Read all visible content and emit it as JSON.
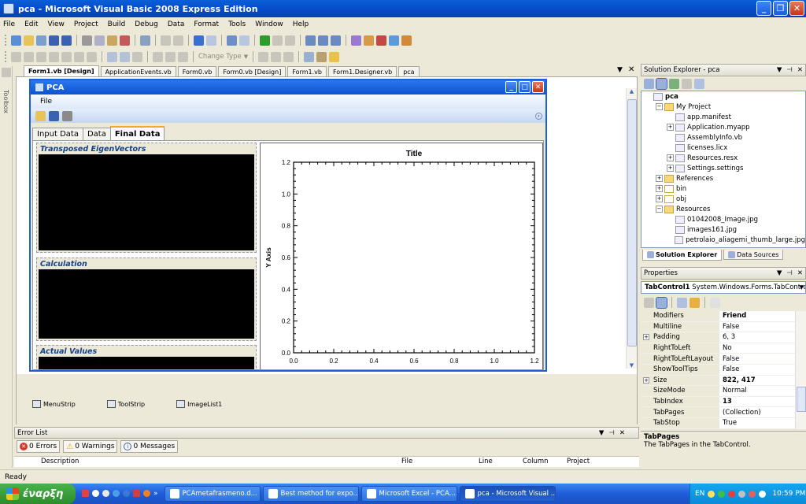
{
  "window": {
    "title": "pca - Microsoft Visual Basic 2008 Express Edition"
  },
  "menu": [
    "File",
    "Edit",
    "View",
    "Project",
    "Build",
    "Debug",
    "Data",
    "Format",
    "Tools",
    "Window",
    "Help"
  ],
  "toolbar2": {
    "change_type": "Change Type"
  },
  "toolbox": {
    "label": "Toolbox"
  },
  "doc_tabs": [
    "Form1.vb [Design]",
    "ApplicationEvents.vb",
    "Form0.vb",
    "Form0.vb [Design]",
    "Form1.vb",
    "Form1.Designer.vb",
    "pca"
  ],
  "form": {
    "title": "PCA",
    "menu_file": "File",
    "tabs": [
      "Input Data",
      "Data",
      "Final Data"
    ],
    "panels": {
      "eigen": "Transposed EigenVectors",
      "calc": "Calculation",
      "actual": "Actual Values"
    }
  },
  "chart_data": {
    "type": "scatter",
    "title": "Title",
    "xlabel": "",
    "ylabel": "Y Axis",
    "xlim": [
      0,
      1.2
    ],
    "ylim": [
      0,
      1.2
    ],
    "xticks": [
      "0.0",
      "0.2",
      "0.4",
      "0.6",
      "0.8",
      "1.0",
      "1.2"
    ],
    "yticks": [
      "0.0",
      "0.2",
      "0.4",
      "0.6",
      "0.8",
      "1.0",
      "1.2"
    ],
    "series": []
  },
  "component_tray": [
    "MenuStrip",
    "ToolStrip",
    "ImageList1"
  ],
  "solution_explorer": {
    "title": "Solution Explorer - pca",
    "items": [
      {
        "label": "pca",
        "level": 0,
        "expander": "",
        "icon": "project",
        "bold": true
      },
      {
        "label": "My Project",
        "level": 1,
        "expander": "−",
        "icon": "folder",
        "bold": false
      },
      {
        "label": "app.manifest",
        "level": 2,
        "expander": "",
        "icon": "file",
        "bold": false
      },
      {
        "label": "Application.myapp",
        "level": 2,
        "expander": "+",
        "icon": "file",
        "bold": false
      },
      {
        "label": "AssemblyInfo.vb",
        "level": 2,
        "expander": "",
        "icon": "file",
        "bold": false
      },
      {
        "label": "licenses.licx",
        "level": 2,
        "expander": "",
        "icon": "file",
        "bold": false
      },
      {
        "label": "Resources.resx",
        "level": 2,
        "expander": "+",
        "icon": "file",
        "bold": false
      },
      {
        "label": "Settings.settings",
        "level": 2,
        "expander": "+",
        "icon": "file",
        "bold": false
      },
      {
        "label": "References",
        "level": 1,
        "expander": "+",
        "icon": "folder",
        "bold": false
      },
      {
        "label": "bin",
        "level": 1,
        "expander": "+",
        "icon": "folder-plain",
        "bold": false
      },
      {
        "label": "obj",
        "level": 1,
        "expander": "+",
        "icon": "folder-plain",
        "bold": false
      },
      {
        "label": "Resources",
        "level": 1,
        "expander": "−",
        "icon": "folder",
        "bold": false
      },
      {
        "label": "01042008_Image.jpg",
        "level": 2,
        "expander": "",
        "icon": "file",
        "bold": false
      },
      {
        "label": "images161.jpg",
        "level": 2,
        "expander": "",
        "icon": "file",
        "bold": false
      },
      {
        "label": "petrolaio_aliagemi_thumb_large.jpg",
        "level": 2,
        "expander": "",
        "icon": "file",
        "bold": false
      }
    ],
    "bottom_tabs": [
      "Solution Explorer",
      "Data Sources"
    ]
  },
  "properties": {
    "title": "Properties",
    "object_name": "TabControl1",
    "object_type": "System.Windows.Forms.TabContro",
    "rows": [
      {
        "name": "Modifiers",
        "value": "Friend",
        "bold": true,
        "expander": ""
      },
      {
        "name": "Multiline",
        "value": "False",
        "bold": false,
        "expander": ""
      },
      {
        "name": "Padding",
        "value": "6, 3",
        "bold": false,
        "expander": "+"
      },
      {
        "name": "RightToLeft",
        "value": "No",
        "bold": false,
        "expander": ""
      },
      {
        "name": "RightToLeftLayout",
        "value": "False",
        "bold": false,
        "expander": ""
      },
      {
        "name": "ShowToolTips",
        "value": "False",
        "bold": false,
        "expander": ""
      },
      {
        "name": "Size",
        "value": "822, 417",
        "bold": true,
        "expander": "+"
      },
      {
        "name": "SizeMode",
        "value": "Normal",
        "bold": false,
        "expander": ""
      },
      {
        "name": "TabIndex",
        "value": "13",
        "bold": true,
        "expander": ""
      },
      {
        "name": "TabPages",
        "value": "(Collection)",
        "bold": false,
        "expander": ""
      },
      {
        "name": "TabStop",
        "value": "True",
        "bold": false,
        "expander": ""
      }
    ],
    "desc_title": "TabPages",
    "desc_text": "The TabPages in the TabControl."
  },
  "error_list": {
    "title": "Error List",
    "errors": "0 Errors",
    "warnings": "0 Warnings",
    "messages": "0 Messages",
    "columns": [
      "Description",
      "File",
      "Line",
      "Column",
      "Project"
    ]
  },
  "status": "Ready",
  "taskbar": {
    "start": "έναρξη",
    "tasks": [
      "PCAmetafrasmeno.d...",
      "Best method for expo...",
      "Microsoft Excel - PCA....",
      "pca - Microsoft Visual ..."
    ],
    "lang": "EN",
    "clock": "10:59 PM"
  },
  "colors": {
    "title_blue": "#0549c7",
    "plot_bg": "#ffffff",
    "panel_black": "#000000",
    "tab_highlight": "#f3a82a"
  }
}
